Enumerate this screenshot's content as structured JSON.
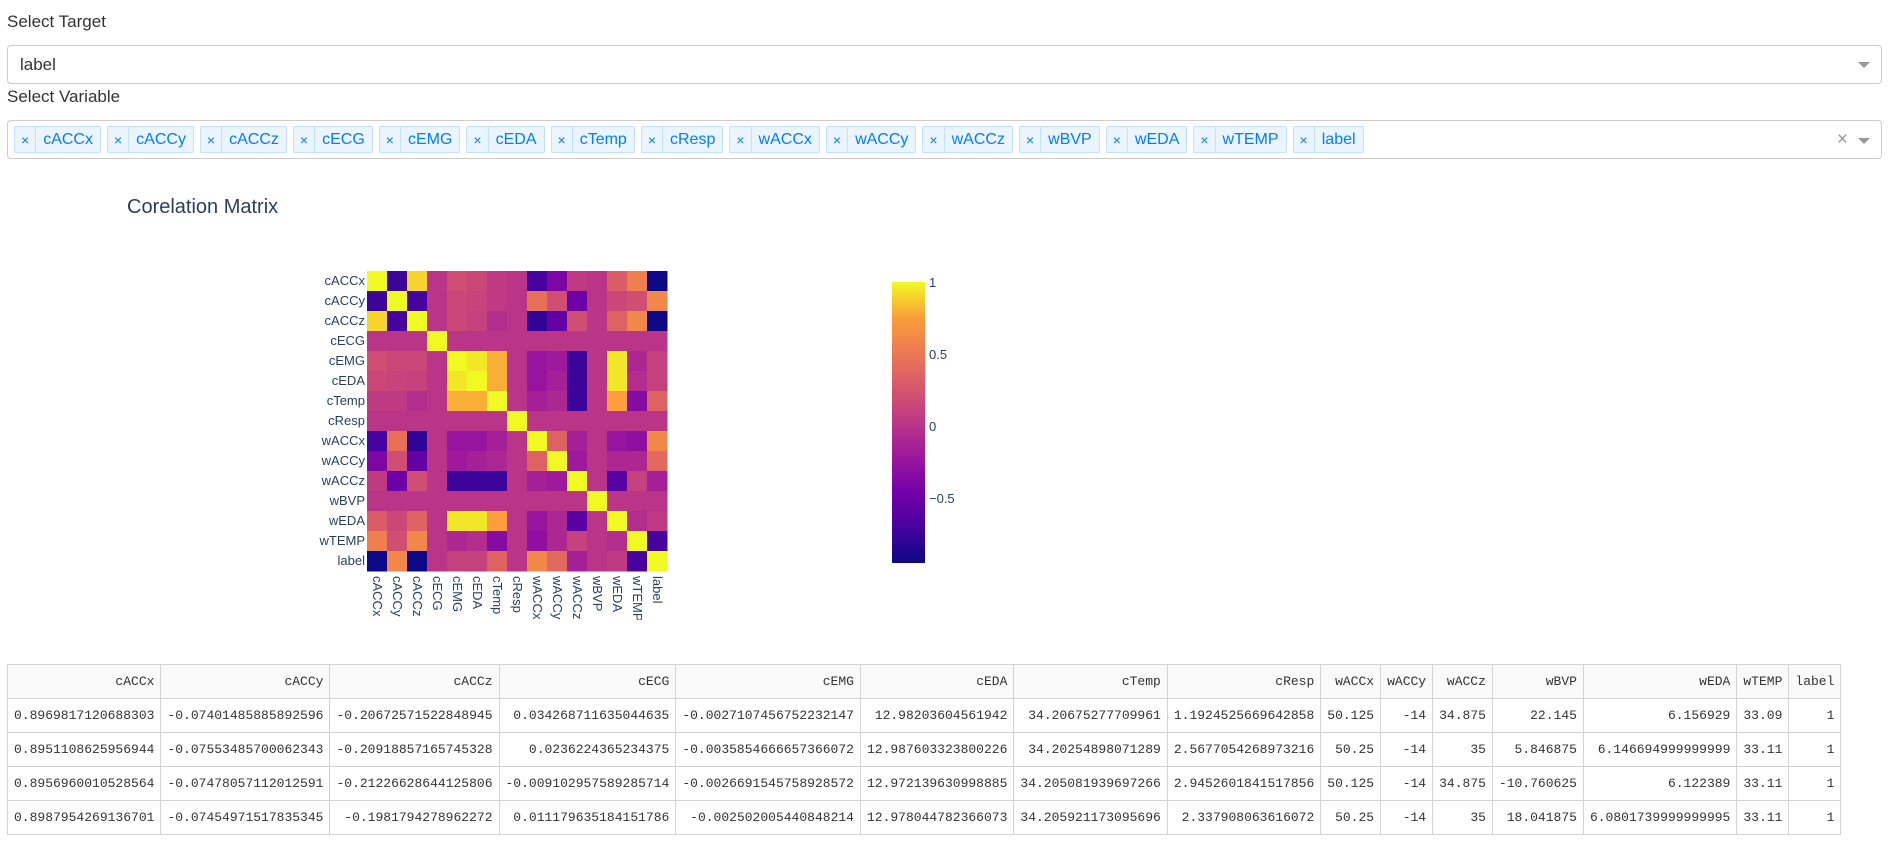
{
  "target": {
    "label": "Select Target",
    "value": "label"
  },
  "variable": {
    "label": "Select Variable",
    "tags": [
      "cACCx",
      "cACCy",
      "cACCz",
      "cECG",
      "cEMG",
      "cEDA",
      "cTemp",
      "cResp",
      "wACCx",
      "wACCy",
      "wACCz",
      "wBVP",
      "wEDA",
      "wTEMP",
      "label"
    ],
    "remove_glyph": "×",
    "clear_glyph": "×"
  },
  "chart_title": "Corelation Matrix",
  "chart_data": {
    "type": "heatmap",
    "title": "Corelation Matrix",
    "x": [
      "cACCx",
      "cACCy",
      "cACCz",
      "cECG",
      "cEMG",
      "cEDA",
      "cTemp",
      "cResp",
      "wACCx",
      "wACCy",
      "wACCz",
      "wBVP",
      "wEDA",
      "wTEMP",
      "label"
    ],
    "y": [
      "cACCx",
      "cACCy",
      "cACCz",
      "cECG",
      "cEMG",
      "cEDA",
      "cTemp",
      "cResp",
      "wACCx",
      "wACCy",
      "wACCz",
      "wBVP",
      "wEDA",
      "wTEMP",
      "label"
    ],
    "z": [
      [
        1.0,
        -0.75,
        0.9,
        0.0,
        0.2,
        0.15,
        0.05,
        0.0,
        -0.7,
        -0.4,
        0.05,
        0.0,
        0.3,
        0.55,
        -0.95
      ],
      [
        -0.75,
        1.0,
        -0.7,
        0.0,
        0.15,
        0.12,
        0.05,
        0.0,
        0.45,
        0.2,
        -0.5,
        0.0,
        0.15,
        0.2,
        0.6
      ],
      [
        0.9,
        -0.7,
        1.0,
        0.0,
        0.15,
        0.1,
        -0.05,
        0.0,
        -0.8,
        -0.55,
        0.2,
        0.0,
        0.35,
        0.6,
        -0.95
      ],
      [
        0.0,
        0.0,
        0.0,
        1.0,
        0.0,
        0.0,
        0.0,
        0.0,
        0.0,
        0.0,
        0.0,
        0.0,
        0.0,
        0.0,
        0.0
      ],
      [
        0.2,
        0.15,
        0.15,
        0.0,
        1.0,
        0.95,
        0.8,
        0.0,
        -0.25,
        -0.2,
        -0.75,
        0.0,
        0.95,
        -0.1,
        0.1
      ],
      [
        0.15,
        0.12,
        0.1,
        0.0,
        0.95,
        1.0,
        0.8,
        0.0,
        -0.25,
        -0.15,
        -0.75,
        0.0,
        0.95,
        -0.05,
        0.1
      ],
      [
        0.05,
        0.05,
        -0.05,
        0.0,
        0.8,
        0.8,
        1.0,
        0.0,
        -0.15,
        -0.1,
        -0.75,
        0.0,
        0.75,
        -0.35,
        0.35
      ],
      [
        0.0,
        0.0,
        0.0,
        0.0,
        0.0,
        0.0,
        0.0,
        1.0,
        0.0,
        0.0,
        0.0,
        0.0,
        0.0,
        0.0,
        0.0
      ],
      [
        -0.7,
        0.45,
        -0.8,
        0.0,
        -0.25,
        -0.25,
        -0.15,
        0.0,
        1.0,
        0.35,
        -0.15,
        0.0,
        -0.25,
        -0.3,
        0.6
      ],
      [
        -0.4,
        0.2,
        -0.55,
        0.0,
        -0.2,
        -0.15,
        -0.1,
        0.0,
        0.35,
        1.0,
        -0.2,
        0.0,
        -0.1,
        -0.1,
        0.4
      ],
      [
        0.05,
        -0.5,
        0.2,
        0.0,
        -0.75,
        -0.75,
        -0.75,
        0.0,
        -0.15,
        -0.2,
        1.0,
        0.0,
        -0.6,
        0.1,
        -0.15
      ],
      [
        0.0,
        0.0,
        0.0,
        0.0,
        0.0,
        0.0,
        0.0,
        0.0,
        0.0,
        0.0,
        0.0,
        1.0,
        0.0,
        0.0,
        0.0
      ],
      [
        0.3,
        0.15,
        0.35,
        0.0,
        0.95,
        0.95,
        0.75,
        0.0,
        -0.25,
        -0.1,
        -0.6,
        0.0,
        1.0,
        -0.05,
        0.05
      ],
      [
        0.55,
        0.2,
        0.6,
        0.0,
        -0.1,
        -0.05,
        -0.35,
        0.0,
        -0.3,
        -0.1,
        0.1,
        0.0,
        -0.05,
        1.0,
        -0.7
      ],
      [
        -0.95,
        0.6,
        -0.95,
        0.0,
        0.1,
        0.1,
        0.35,
        0.0,
        0.6,
        0.4,
        -0.15,
        0.0,
        0.05,
        -0.7,
        1.0
      ]
    ],
    "colorscale": "plasma",
    "zmin": -0.95,
    "zmax": 1,
    "colorbar_ticks": [
      1,
      0.5,
      0,
      -0.5
    ],
    "colorbar_tick_labels": [
      "1",
      "0.5",
      "0",
      "−0.5"
    ]
  },
  "table": {
    "columns": [
      "cACCx",
      "cACCy",
      "cACCz",
      "cECG",
      "cEMG",
      "cEDA",
      "cTemp",
      "cResp",
      "wACCx",
      "wACCy",
      "wACCz",
      "wBVP",
      "wEDA",
      "wTEMP",
      "label"
    ],
    "rows": [
      [
        "0.8969817120688303",
        "-0.07401485885892596",
        "-0.20672571522848945",
        "0.034268711635044635",
        "-0.0027107456752232147",
        "12.98203604561942",
        "34.20675277709961",
        "1.1924525669642858",
        "50.125",
        "-14",
        "34.875",
        "22.145",
        "6.156929",
        "33.09",
        "1"
      ],
      [
        "0.8951108625956944",
        "-0.07553485700062343",
        "-0.20918857165745328",
        "0.0236224365234375",
        "-0.0035854666657366072",
        "12.987603323800226",
        "34.20254898071289",
        "2.5677054268973216",
        "50.25",
        "-14",
        "35",
        "5.846875",
        "6.146694999999999",
        "33.11",
        "1"
      ],
      [
        "0.8956960010528564",
        "-0.07478057112012591",
        "-0.21226628644125806",
        "-0.009102957589285714",
        "-0.0026691545758928572",
        "12.972139630998885",
        "34.205081939697266",
        "2.9452601841517856",
        "50.125",
        "-14",
        "34.875",
        "-10.760625",
        "6.122389",
        "33.11",
        "1"
      ],
      [
        "0.8987954269136701",
        "-0.07454971517835345",
        "-0.1981794278962272",
        "0.011179635184151786",
        "-0.002502005440848214",
        "12.978044782366073",
        "34.205921173095696",
        "2.337908063616072",
        "50.25",
        "-14",
        "35",
        "18.041875",
        "6.0801739999999995",
        "33.11",
        "1"
      ]
    ]
  }
}
